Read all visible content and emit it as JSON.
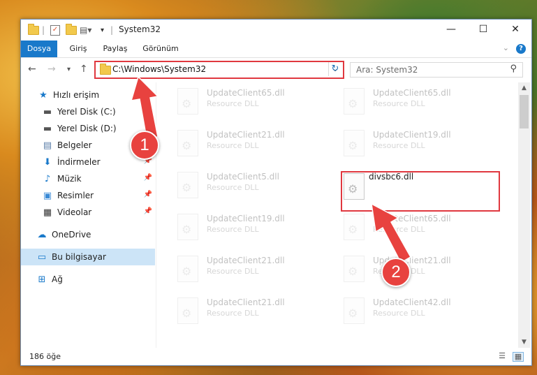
{
  "window": {
    "title": "System32",
    "controls": {
      "minimize": "—",
      "maximize": "☐",
      "close": "✕"
    }
  },
  "ribbon": {
    "tabs": [
      {
        "label": "Dosya",
        "active": true
      },
      {
        "label": "Giriş"
      },
      {
        "label": "Paylaş"
      },
      {
        "label": "Görünüm"
      }
    ],
    "help": "?"
  },
  "address": {
    "path": "C:\\Windows\\System32"
  },
  "search": {
    "placeholder": "Ara: System32"
  },
  "sidebar": {
    "quick_access": "Hızlı erişim",
    "items": [
      {
        "label": "Yerel Disk (C:)",
        "icon": "drive-icon",
        "pinned": true
      },
      {
        "label": "Yerel Disk (D:)",
        "icon": "drive-icon",
        "pinned": true
      },
      {
        "label": "Belgeler",
        "icon": "documents-icon",
        "pinned": true
      },
      {
        "label": "İndirmeler",
        "icon": "download-icon",
        "pinned": true
      },
      {
        "label": "Müzik",
        "icon": "music-icon",
        "pinned": true
      },
      {
        "label": "Resimler",
        "icon": "pictures-icon",
        "pinned": true
      },
      {
        "label": "Videolar",
        "icon": "videos-icon",
        "pinned": true
      }
    ],
    "onedrive": "OneDrive",
    "this_pc": "Bu bilgisayar",
    "network": "Ağ"
  },
  "files": [
    {
      "name": "UpdateClient65.dll",
      "type": "Resource DLL",
      "faded": true
    },
    {
      "name": "UpdateClient65.dll",
      "type": "Resource DLL",
      "faded": true
    },
    {
      "name": "UpdateClient21.dll",
      "type": "Resource DLL",
      "faded": true
    },
    {
      "name": "UpdateClient19.dll",
      "type": "Resource DLL",
      "faded": true
    },
    {
      "name": "UpdateClient5.dll",
      "type": "Resource DLL",
      "faded": true
    },
    {
      "name": "divsbc6.dll",
      "type": "",
      "faded": false
    },
    {
      "name": "UpdateClient19.dll",
      "type": "Resource DLL",
      "faded": true
    },
    {
      "name": "UpdateClient65.dll",
      "type": "Resource DLL",
      "faded": true
    },
    {
      "name": "UpdateClient21.dll",
      "type": "Resource DLL",
      "faded": true
    },
    {
      "name": "UpdateClient21.dll",
      "type": "Resource DLL",
      "faded": true
    },
    {
      "name": "UpdateClient21.dll",
      "type": "Resource DLL",
      "faded": true
    },
    {
      "name": "UpdateClient42.dll",
      "type": "Resource DLL",
      "faded": true
    }
  ],
  "status": {
    "count": "186 öğe"
  },
  "callouts": {
    "one": "1",
    "two": "2"
  },
  "colors": {
    "accent": "#1979ca",
    "highlight": "#e0383f",
    "selected": "#cce4f7"
  }
}
